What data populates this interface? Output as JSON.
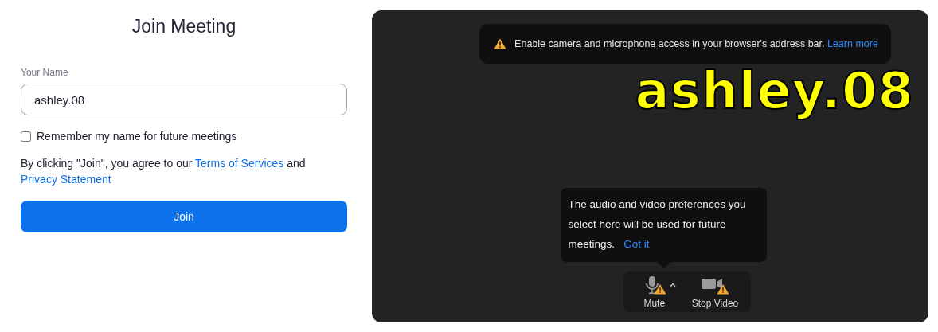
{
  "join_panel": {
    "title": "Join Meeting",
    "name_field": {
      "label": "Your Name",
      "value": "ashley.08"
    },
    "remember": {
      "label": "Remember my name for future meetings",
      "checked": false
    },
    "agreement": [
      {
        "kind": "text",
        "text": "By clicking \"Join\", you agree to our "
      },
      {
        "kind": "link",
        "text": "Terms of Services"
      },
      {
        "kind": "text",
        "text": " and "
      },
      {
        "kind": "link",
        "text": "Privacy Statement"
      }
    ],
    "join_button": "Join"
  },
  "preview": {
    "banner": {
      "text": "Enable camera and microphone access in your browser's address bar.",
      "link": "Learn more"
    },
    "overlay_text": "ashley.08",
    "tooltip": {
      "text": "The audio and video preferences you select here will be used for future meetings.",
      "link": "Got it"
    },
    "controls": [
      {
        "kind": "mic",
        "label": "Mute",
        "warning": true
      },
      {
        "kind": "camera",
        "label": "Stop Video",
        "warning": true
      }
    ]
  }
}
